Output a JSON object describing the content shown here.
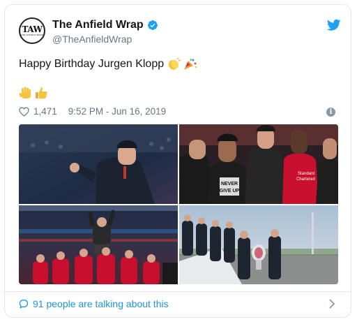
{
  "tweet": {
    "author": {
      "display_name": "The Anfield Wrap",
      "handle": "@TheAnfieldWrap",
      "verified": true,
      "avatar": {
        "logo_text": "TAW",
        "logo_subtext": "THE ANFIELD WRAP"
      }
    },
    "text": "Happy Birthday Jurgen Klopp",
    "text_emojis": [
      "clapping-hands",
      "party-popper"
    ],
    "extra_emojis": [
      "raised-hand",
      "thumbs-up"
    ],
    "likes": "1,471",
    "timestamp": "9:52 PM - Jun 16, 2019",
    "footer": {
      "conversation_text": "91 people are talking about this"
    },
    "photos": [
      {
        "name": "klopp-celebrating-stadium",
        "shirt_text": ""
      },
      {
        "name": "players-celebrating-group",
        "shirt_text": "NEVER GIVE UP",
        "sponsor_text": "Standard Chartered"
      },
      {
        "name": "players-lifting-manager",
        "shirt_text": ""
      },
      {
        "name": "team-arrival-airport",
        "shirt_text": ""
      }
    ]
  },
  "colors": {
    "link": "#1b95e0",
    "verified": "#1da1f2",
    "muted": "#657786",
    "border": "#e1e8ed"
  }
}
